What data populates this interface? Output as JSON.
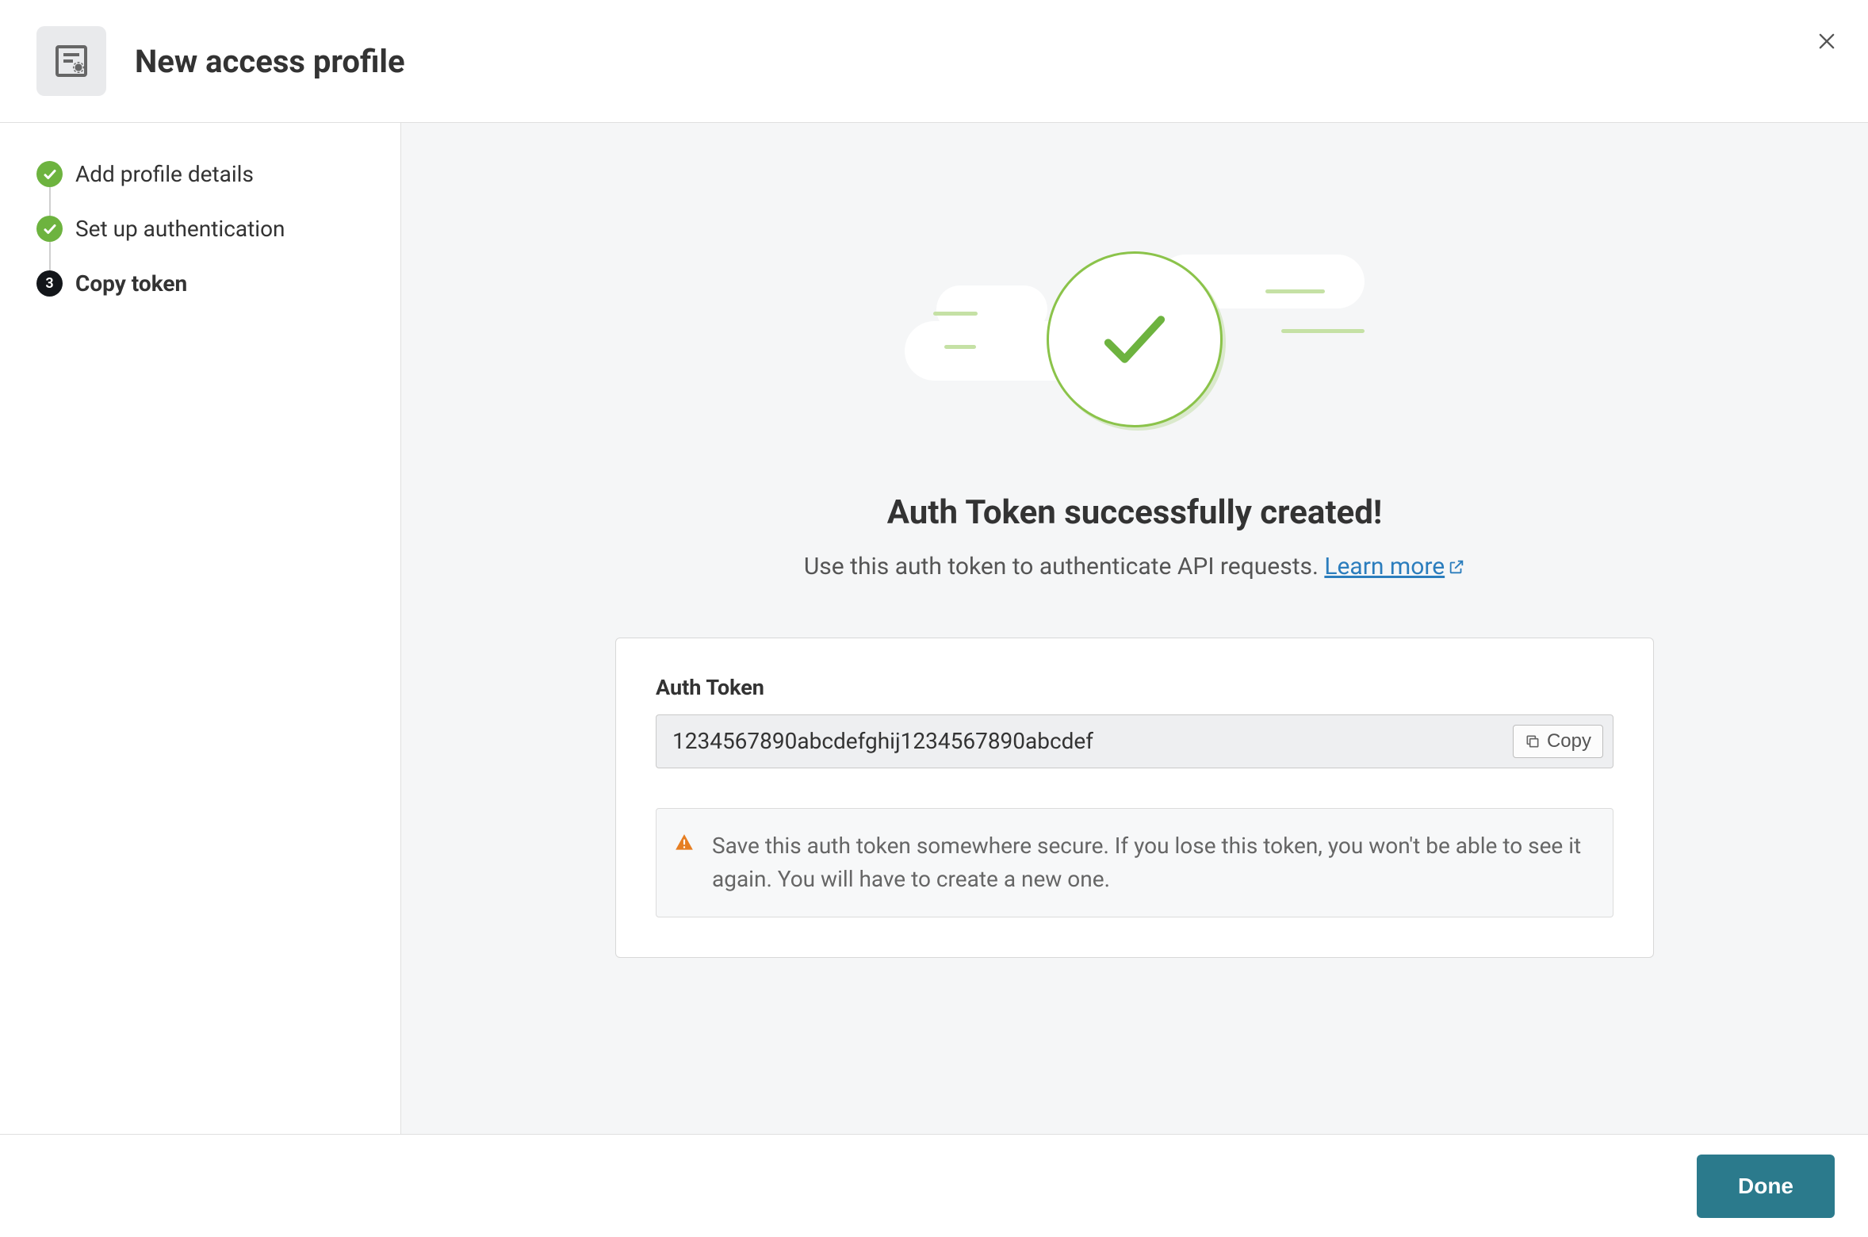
{
  "header": {
    "title": "New access profile"
  },
  "sidebar": {
    "steps": [
      {
        "label": "Add profile details",
        "state": "completed"
      },
      {
        "label": "Set up authentication",
        "state": "completed"
      },
      {
        "label": "Copy token",
        "state": "current",
        "number": "3"
      }
    ]
  },
  "content": {
    "heading": "Auth Token successfully created!",
    "subtext": "Use this auth token to authenticate API requests.",
    "learn_more_label": "Learn more",
    "token_label": "Auth Token",
    "token_value": "1234567890abcdefghij1234567890abcdef",
    "copy_label": "Copy",
    "warning_text": "Save this auth token somewhere secure. If you lose this token, you won't be able to see it again. You will have to create a new one."
  },
  "footer": {
    "done_label": "Done"
  }
}
